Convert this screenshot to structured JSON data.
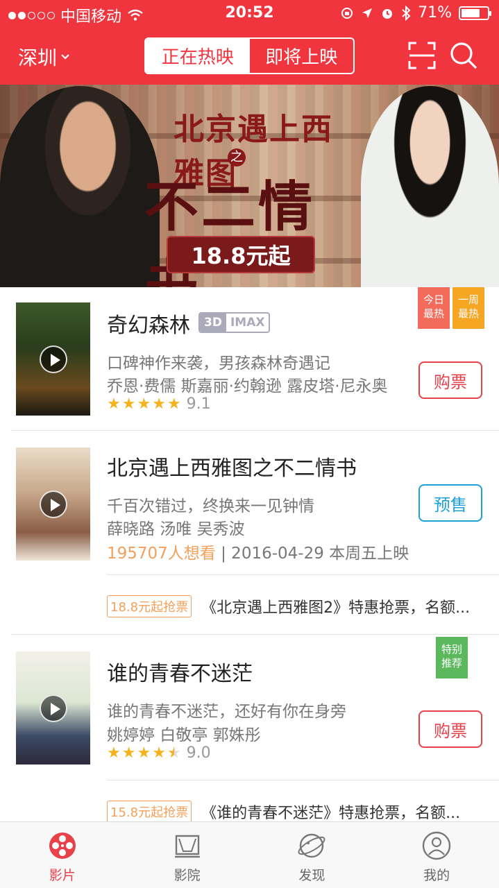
{
  "status_bar": {
    "carrier": "中国移动",
    "time": "20:52",
    "battery": "71%",
    "battery_level": 0.71
  },
  "header": {
    "city": "深圳",
    "tabs": [
      {
        "label": "正在热映",
        "active": true
      },
      {
        "label": "即将上映",
        "active": false
      }
    ]
  },
  "banner": {
    "title_top": "北京遇上西雅图",
    "subtitle_small": "之",
    "title_main": "不二情书",
    "price": "18.8元起"
  },
  "movies": [
    {
      "title": "奇幻森林",
      "badge": [
        "3D",
        "IMAX"
      ],
      "desc": "口碑神作来袭，男孩森林奇遇记",
      "cast": "乔恩·费儒 斯嘉丽·约翰逊 露皮塔·尼永奥",
      "rating": 9.1,
      "rating_text": "9.1",
      "button": "购票",
      "tags": [
        {
          "text": "今日最热",
          "color": "#f26b5b"
        },
        {
          "text": "一周最热",
          "color": "#f5a623"
        }
      ]
    },
    {
      "title": "北京遇上西雅图之不二情书",
      "desc": "千百次错过，终换来一见钟情",
      "cast": "薛晓路 汤唯 吴秀波",
      "want": "195707人想看",
      "release": "| 2016-04-29 本周五上映",
      "button": "预售",
      "promo_tag": "18.8元起抢票",
      "promo_text": "《北京遇上西雅图2》特惠抢票，名额..."
    },
    {
      "title": "谁的青春不迷茫",
      "desc": "谁的青春不迷茫，还好有你在身旁",
      "cast": "姚婷婷 白敬亭 郭姝彤",
      "rating": 9.0,
      "rating_text": "9.0",
      "button": "购票",
      "tags": [
        {
          "text": "特别推荐",
          "color": "#5bb85d"
        }
      ],
      "promo_tag": "15.8元起抢票",
      "promo_text": "《谁的青春不迷茫》特惠抢票，名额..."
    }
  ],
  "bottom_nav": [
    {
      "label": "影片",
      "icon": "film-reel-icon",
      "active": true
    },
    {
      "label": "影院",
      "icon": "cinema-screen-icon",
      "active": false
    },
    {
      "label": "发现",
      "icon": "planet-icon",
      "active": false
    },
    {
      "label": "我的",
      "icon": "user-icon",
      "active": false
    }
  ],
  "colors": {
    "brand": "#f0353f",
    "buy": "#e8414a",
    "presale": "#1ea0d8",
    "promo": "#f2a05a",
    "star": "#f6b21c"
  }
}
